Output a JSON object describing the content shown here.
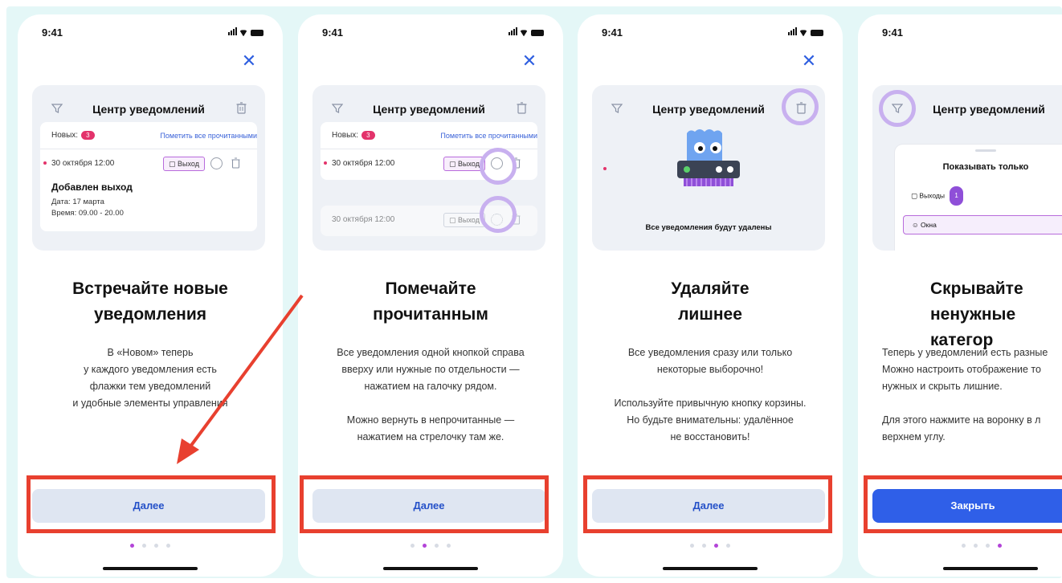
{
  "status": {
    "time": "9:41"
  },
  "common": {
    "card_title": "Центр уведомлений",
    "new_label": "Новых:",
    "new_count": "3",
    "mark_all": "Пометить все прочитанными",
    "date": "30 октября 12:00",
    "tag_exit": "Выход",
    "next_button": "Далее"
  },
  "screen1": {
    "detail_title": "Добавлен выход",
    "detail_line1": "Дата: 17 марта",
    "detail_line2": "Время: 09.00 - 20.00",
    "headline": "Встречайте новые\nуведомления",
    "body": "В «Новом» теперь\nу каждого уведомления есть\nфлажки тем уведомлений\nи удобные элементы управления"
  },
  "screen2": {
    "headline": "Помечайте\nпрочитанным",
    "body": "Все уведомления одной кнопкой справа\nвверху или нужные по отдельности —\nнажатием на галочку рядом.\n\nМожно вернуть в непрочитанные —\nнажатием на стрелочку там же."
  },
  "screen3": {
    "caption": "Все уведомления будут удалены",
    "headline": "Удаляйте\nлишнее",
    "body": "Все уведомления сразу или только\nнекоторые выборочно!\n\nИспользуйте привычную кнопку корзины.\nНо будьте внимательны: удалённое\nне восстановить!"
  },
  "screen4": {
    "sheet_title": "Показывать только",
    "filter_exits": "Выходы",
    "filter_exits_count": "1",
    "filter_windows": "Окна",
    "headline": "Скрывайте\nненужные категор",
    "body": "Теперь у уведомлений есть разные\nМожно настроить отображение то\nнужных и скрыть лишние.\n\nДля этого нажмите на воронку в л\nверхнем углу.",
    "close_button": "Закрыть"
  },
  "colors": {
    "accent_blue": "#2f5fe8",
    "badge_pink": "#e3336b",
    "highlight_purple": "#c8b0ef",
    "annotation_red": "#e8402f",
    "backdrop": "#e4f7f7"
  },
  "pager": {
    "total": 4
  }
}
